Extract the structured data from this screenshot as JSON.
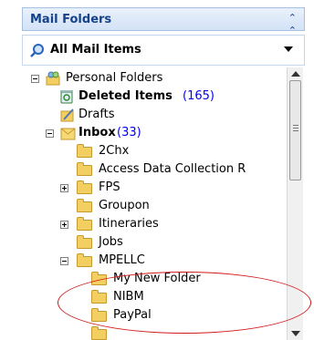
{
  "header": {
    "title": "Mail Folders",
    "collapse_icon": "double-chevron-up-icon"
  },
  "all_mail": {
    "label": "All Mail Items"
  },
  "tree": {
    "personal": "Personal Folders",
    "deleted": {
      "label": "Deleted Items",
      "count": "(165)"
    },
    "drafts": "Drafts",
    "inbox": {
      "label": "Inbox",
      "count": "(33)"
    },
    "chx": "2Chx",
    "access": "Access Data Collection R",
    "fps": "FPS",
    "groupon": "Groupon",
    "itineraries": "Itineraries",
    "jobs": "Jobs",
    "mpellc": "MPELLC",
    "mynew": "My New Folder",
    "nibm": "NIBM",
    "paypal": "PayPal"
  },
  "colors": {
    "header_text": "#15428b",
    "count": "#0000ff",
    "highlight_ellipse": "#d11818"
  }
}
